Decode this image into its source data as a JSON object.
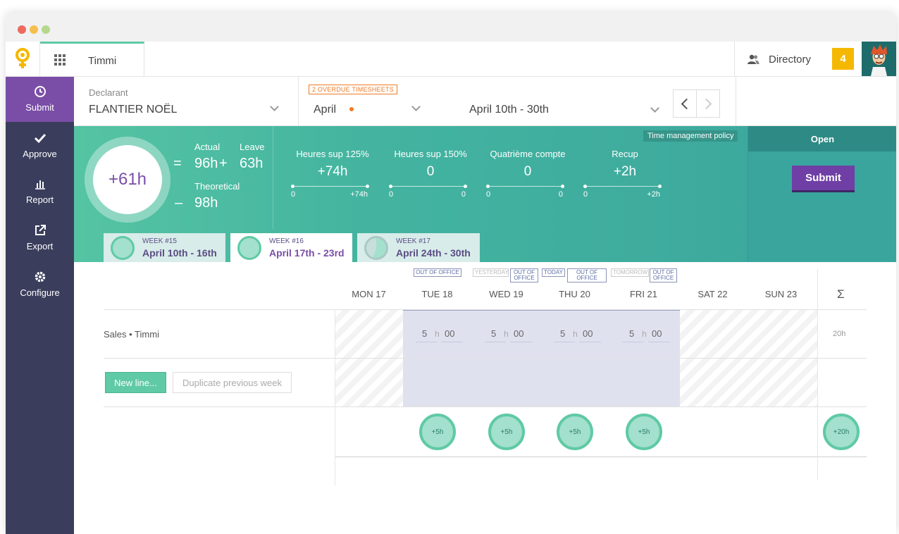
{
  "app": {
    "name": "Timmi"
  },
  "topnav": {
    "directory_label": "Directory",
    "notifications": "4"
  },
  "sidebar": {
    "items": [
      {
        "label": "Submit",
        "icon": "clock-icon"
      },
      {
        "label": "Approve",
        "icon": "check-icon"
      },
      {
        "label": "Report",
        "icon": "bar-chart-icon"
      },
      {
        "label": "Export",
        "icon": "external-link-icon"
      },
      {
        "label": "Configure",
        "icon": "gear-icon"
      }
    ]
  },
  "declarant": {
    "caption": "Declarant",
    "value": "FLANTIER NOËL"
  },
  "period": {
    "overdue": "2 OVERDUE TIMESHEETS",
    "month": "April",
    "range": "April 10th - 30th"
  },
  "summary": {
    "balance": "+61h",
    "actual_label": "Actual",
    "actual_value": "96h",
    "leave_label": "Leave",
    "leave_value": "63h",
    "theoretical_label": "Theoretical",
    "theoretical_value": "98h",
    "eq": "=",
    "plus": "+",
    "minus": "–",
    "policy": "Time management policy",
    "counters": [
      {
        "title": "Heures sup 125%",
        "value": "+74h",
        "min": "0",
        "max": "+74h"
      },
      {
        "title": "Heures sup 150%",
        "value": "0",
        "min": "0",
        "max": "0"
      },
      {
        "title": "Quatrième compte",
        "value": "0",
        "min": "0",
        "max": "0"
      },
      {
        "title": "Recup",
        "value": "+2h",
        "min": "0",
        "max": "+2h"
      }
    ],
    "status": "Open",
    "submit_label": "Submit"
  },
  "weeks": [
    {
      "week": "WEEK #15",
      "range": "April 10th - 16th"
    },
    {
      "week": "WEEK #16",
      "range": "April 17th - 23rd"
    },
    {
      "week": "WEEK #17",
      "range": "April 24th - 30th"
    }
  ],
  "days": [
    {
      "label": "MON 17"
    },
    {
      "label": "TUE 18"
    },
    {
      "label": "WED 19"
    },
    {
      "label": "THU 20"
    },
    {
      "label": "FRI 21"
    },
    {
      "label": "SAT 22"
    },
    {
      "label": "SUN 23"
    }
  ],
  "badges": {
    "tue": "OUT OF OFFICE",
    "yesterday": "YESTERDAY",
    "wed": "OUT OF OFFICE",
    "today": "TODAY",
    "thu": "OUT OF OFFICE",
    "tomorrow": "TOMORROW",
    "fri": "OUT OF OFFICE"
  },
  "sum_symbol": "Σ",
  "timesheet": {
    "line_label": "Sales • Timmi",
    "entries": [
      {
        "hours": "5",
        "h": "h",
        "minutes": "00"
      },
      {
        "hours": "5",
        "h": "h",
        "minutes": "00"
      },
      {
        "hours": "5",
        "h": "h",
        "minutes": "00"
      },
      {
        "hours": "5",
        "h": "h",
        "minutes": "00"
      }
    ],
    "line_total": "20h",
    "new_line": "New line...",
    "duplicate": "Duplicate previous week",
    "day_totals": [
      "+5h",
      "+5h",
      "+5h",
      "+5h"
    ],
    "grand_total": "+20h"
  },
  "colors": {
    "accent": "#5fcaa5",
    "purple": "#7a4ea7",
    "sidebar": "#3a3d5c",
    "orange": "#f07a23"
  }
}
